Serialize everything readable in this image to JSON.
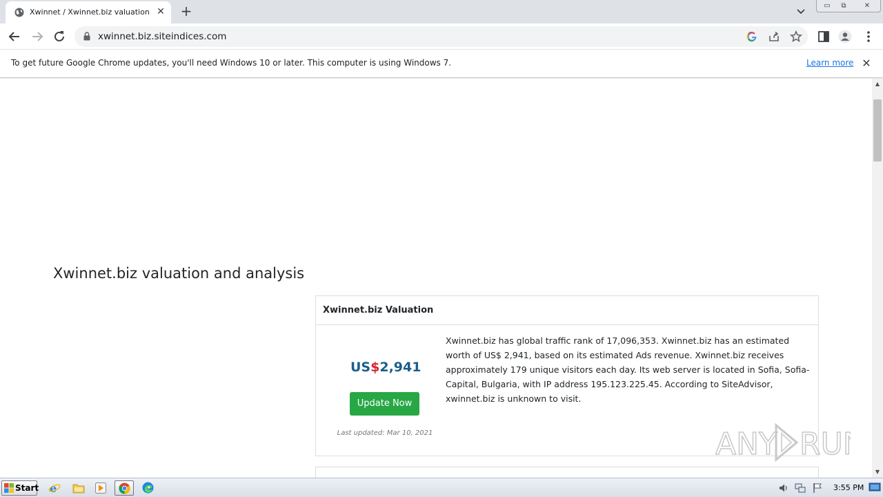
{
  "browser": {
    "tab_title": "Xwinnet / Xwinnet.biz valuation and",
    "url": "xwinnet.biz.siteindices.com",
    "infobar_text": "To get future Google Chrome updates, you'll need Windows 10 or later. This computer is using Windows 7.",
    "infobar_link": "Learn more",
    "icons": [
      "globe-icon",
      "close-icon",
      "plus-icon",
      "chevron-down-icon",
      "back-icon",
      "forward-icon",
      "reload-icon",
      "lock-icon",
      "google-icon",
      "share-icon",
      "star-icon",
      "side-panel-icon",
      "profile-icon",
      "menu-icon"
    ]
  },
  "page": {
    "title": "Xwinnet.biz valuation and analysis",
    "card": {
      "header": "Xwinnet.biz Valuation",
      "price_prefix": "US",
      "price_symbol": "$",
      "price_value": "2,941",
      "update_button": "Update Now",
      "last_updated": "Last updated: Mar 10, 2021",
      "description": "Xwinnet.biz has global traffic rank of 17,096,353. Xwinnet.biz has an estimated worth of US$ 2,941, based on its estimated Ads revenue. Xwinnet.biz receives approximately 179 unique visitors each day. Its web server is located in Sofia, Sofia-Capital, Bulgaria, with IP address 195.123.225.45. According to SiteAdvisor, xwinnet.biz is unknown to visit."
    },
    "watermark": "ANY RUN",
    "colors": {
      "price": "#1a5f8a",
      "dollar": "#d9252f",
      "button": "#28a745"
    }
  },
  "taskbar": {
    "start_label": "Start",
    "clock": "3:55 PM",
    "apps": [
      "ie-icon",
      "explorer-icon",
      "media-player-icon",
      "chrome-icon",
      "edge-icon"
    ]
  }
}
